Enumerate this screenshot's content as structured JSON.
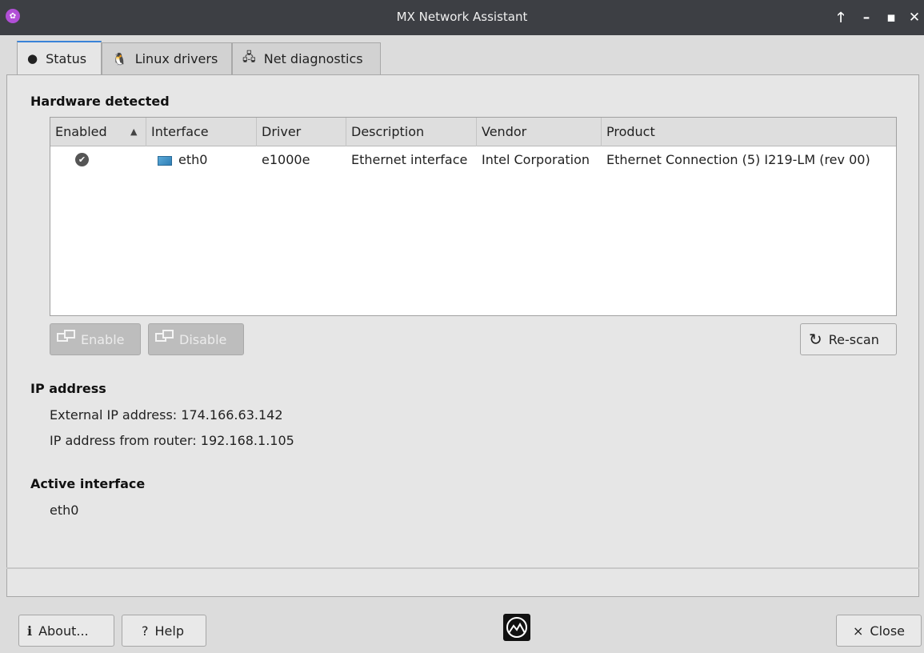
{
  "window": {
    "title": "MX Network Assistant",
    "controls": {
      "keep_above": "🡑",
      "minimize": "–",
      "maximize": "▪",
      "close": "✕"
    }
  },
  "tabs": [
    {
      "label": "Status",
      "icon": "status-icon",
      "active": true
    },
    {
      "label": "Linux drivers",
      "icon": "tux-icon",
      "active": false
    },
    {
      "label": "Net diagnostics",
      "icon": "diagnostics-icon",
      "active": false
    }
  ],
  "hardware": {
    "heading": "Hardware detected",
    "columns": [
      "Enabled",
      "Interface",
      "Driver",
      "Description",
      "Vendor",
      "Product"
    ],
    "sort_indicator": "▲",
    "rows": [
      {
        "enabled": true,
        "interface": "eth0",
        "driver": "e1000e",
        "description": "Ethernet interface",
        "vendor": "Intel Corporation",
        "product": "Ethernet Connection (5) I219-LM (rev 00)"
      }
    ],
    "enable_label": "Enable",
    "disable_label": "Disable",
    "rescan_label": "Re-scan"
  },
  "ip": {
    "heading": "IP address",
    "external": "External IP address: 174.166.63.142",
    "router": "IP address from router: 192.168.1.105"
  },
  "active": {
    "heading": "Active interface",
    "value": "eth0"
  },
  "footer": {
    "about_label": "About...",
    "help_label": "Help",
    "close_label": "Close"
  }
}
